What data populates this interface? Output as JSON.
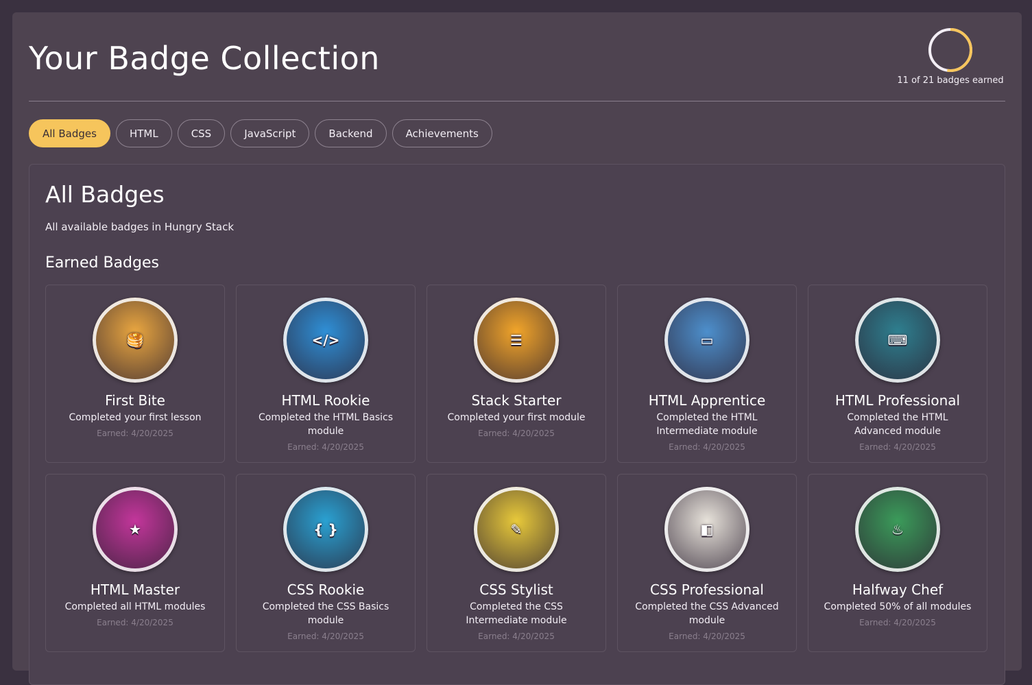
{
  "page_title": "Your Badge Collection",
  "progress": {
    "earned": 11,
    "total": 21,
    "fraction": 0.5238,
    "text": "11 of 21 badges earned",
    "color": "#f6c55c"
  },
  "tabs": [
    {
      "label": "All Badges",
      "active": true
    },
    {
      "label": "HTML",
      "active": false
    },
    {
      "label": "CSS",
      "active": false
    },
    {
      "label": "JavaScript",
      "active": false
    },
    {
      "label": "Backend",
      "active": false
    },
    {
      "label": "Achievements",
      "active": false
    }
  ],
  "section": {
    "title": "All Badges",
    "subtitle": "All available badges in Hungry Stack",
    "earned_heading": "Earned Badges"
  },
  "badges": [
    {
      "name": "First Bite",
      "description": "Completed your first lesson",
      "earned": "Earned: 4/20/2025",
      "icon": "pancake-badge-icon",
      "bg": "#e9a640"
    },
    {
      "name": "HTML Rookie",
      "description": "Completed the HTML Basics module",
      "earned": "Earned: 4/20/2025",
      "icon": "html-learner-badge-icon",
      "bg": "#2f8fd6"
    },
    {
      "name": "Stack Starter",
      "description": "Completed your first module",
      "earned": "Earned: 4/20/2025",
      "icon": "stack-starter-badge-icon",
      "bg": "#f2a52a"
    },
    {
      "name": "HTML Apprentice",
      "description": "Completed the HTML Intermediate module",
      "earned": "Earned: 4/20/2025",
      "icon": "html-apprentice-badge-icon",
      "bg": "#4d8fcc"
    },
    {
      "name": "HTML Professional",
      "description": "Completed the HTML Advanced module",
      "earned": "Earned: 4/20/2025",
      "icon": "html-pro-badge-icon",
      "bg": "#2e7f8f"
    },
    {
      "name": "HTML Master",
      "description": "Completed all HTML modules",
      "earned": "Earned: 4/20/2025",
      "icon": "html-master-badge-icon",
      "bg": "#c3369b"
    },
    {
      "name": "CSS Rookie",
      "description": "Completed the CSS Basics module",
      "earned": "Earned: 4/20/2025",
      "icon": "css-rookie-badge-icon",
      "bg": "#2aa1d2"
    },
    {
      "name": "CSS Stylist",
      "description": "Completed the CSS Intermediate module",
      "earned": "Earned: 4/20/2025",
      "icon": "css-stylist-badge-icon",
      "bg": "#e8c93a"
    },
    {
      "name": "CSS Professional",
      "description": "Completed the CSS Advanced module",
      "earned": "Earned: 4/20/2025",
      "icon": "css-pro-badge-icon",
      "bg": "#e7e2da"
    },
    {
      "name": "Halfway Chef",
      "description": "Completed 50% of all modules",
      "earned": "Earned: 4/20/2025",
      "icon": "halfway-chef-badge-icon",
      "bg": "#3b9b5a"
    }
  ]
}
